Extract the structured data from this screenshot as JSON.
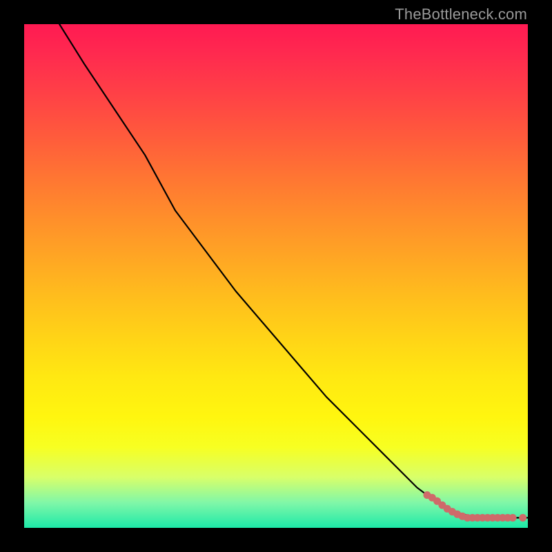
{
  "watermark": "TheBottleneck.com",
  "chart_data": {
    "type": "line",
    "title": "",
    "xlabel": "",
    "ylabel": "",
    "xlim": [
      0,
      100
    ],
    "ylim": [
      0,
      100
    ],
    "grid": false,
    "legend": false,
    "series": [
      {
        "name": "bottleneck-curve",
        "color": "#000000",
        "x": [
          7,
          12,
          18,
          24,
          30,
          36,
          42,
          48,
          54,
          60,
          66,
          72,
          78,
          82,
          86,
          90,
          94,
          98,
          100
        ],
        "y": [
          100,
          92,
          83,
          74,
          63,
          55,
          47,
          40,
          33,
          26,
          20,
          14,
          8,
          5,
          3,
          2,
          2,
          2,
          2
        ]
      }
    ],
    "scatter": {
      "name": "marker-points",
      "color": "#cf6a6a",
      "points": [
        {
          "x": 80,
          "y": 6.5
        },
        {
          "x": 81,
          "y": 6.0
        },
        {
          "x": 82,
          "y": 5.3
        },
        {
          "x": 83,
          "y": 4.5
        },
        {
          "x": 84,
          "y": 3.8
        },
        {
          "x": 85,
          "y": 3.2
        },
        {
          "x": 86,
          "y": 2.7
        },
        {
          "x": 87,
          "y": 2.3
        },
        {
          "x": 88,
          "y": 2.0
        },
        {
          "x": 89,
          "y": 2.0
        },
        {
          "x": 90,
          "y": 2.0
        },
        {
          "x": 91,
          "y": 2.0
        },
        {
          "x": 92,
          "y": 2.0
        },
        {
          "x": 93,
          "y": 2.0
        },
        {
          "x": 94,
          "y": 2.0
        },
        {
          "x": 95,
          "y": 2.0
        },
        {
          "x": 96,
          "y": 2.0
        },
        {
          "x": 97,
          "y": 2.0
        },
        {
          "x": 99,
          "y": 2.0
        }
      ]
    }
  }
}
